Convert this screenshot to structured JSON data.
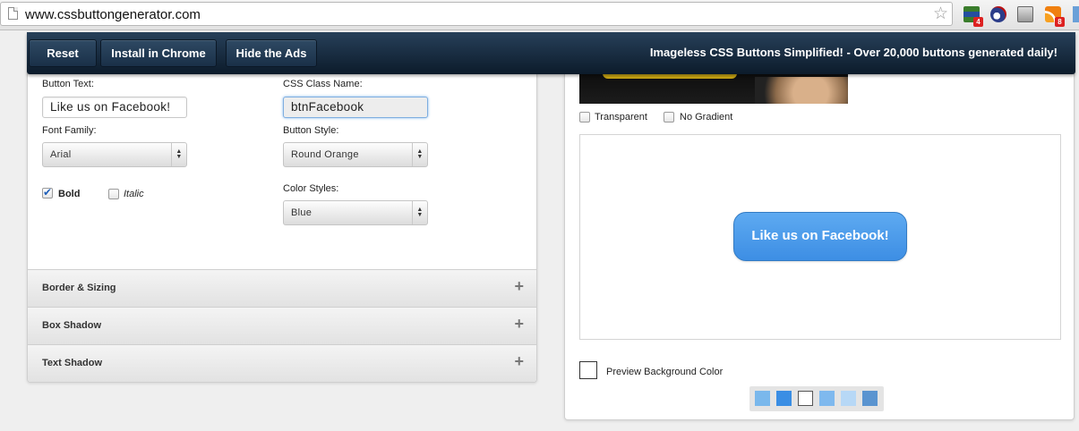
{
  "browser": {
    "url": "www.cssbuttongenerator.com",
    "extensions": [
      {
        "name": "ext-grid-icon",
        "badge": "4"
      },
      {
        "name": "ext-gauge-icon",
        "badge": ""
      },
      {
        "name": "ext-chart-icon",
        "badge": ""
      },
      {
        "name": "rss-icon",
        "badge": "8"
      }
    ]
  },
  "toolbar": {
    "reset_label": "Reset",
    "install_label": "Install in Chrome",
    "hide_ads_label": "Hide the Ads",
    "tagline": "Imageless CSS Buttons Simplified! - Over 20,000 buttons generated daily!"
  },
  "form": {
    "button_text_label": "Button Text:",
    "button_text_value": "Like us on Facebook!",
    "css_class_label": "CSS Class Name:",
    "css_class_value": "btnFacebook",
    "font_family_label": "Font Family:",
    "font_family_value": "Arial",
    "button_style_label": "Button Style:",
    "button_style_value": "Round Orange",
    "bold_label": "Bold",
    "bold_checked": true,
    "italic_label": "Italic",
    "italic_checked": false,
    "color_styles_label": "Color Styles:",
    "color_styles_value": "Blue"
  },
  "sections": [
    {
      "title": "Border & Sizing"
    },
    {
      "title": "Box Shadow"
    },
    {
      "title": "Text Shadow"
    }
  ],
  "preview": {
    "transparent_label": "Transparent",
    "no_gradient_label": "No Gradient",
    "button_label": "Like us on Facebook!",
    "button_color": "#4a9aec",
    "bg_color_label": "Preview Background Color",
    "swatches": [
      "#7ab8ec",
      "#3a8ee4",
      "#ffffff",
      "#7fb9ee",
      "#b7d8f6",
      "#5a94d0"
    ]
  }
}
